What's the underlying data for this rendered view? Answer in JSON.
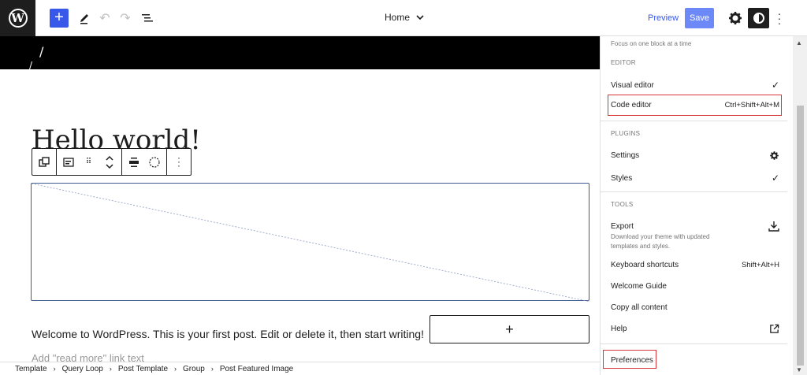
{
  "header": {
    "logo_letter": "W",
    "add_icon": "plus-icon",
    "doc_title": "Home",
    "preview_label": "Preview",
    "save_label": "Save"
  },
  "canvas": {
    "post_title": "Hello world!",
    "excerpt": "Welcome to WordPress. This is your first post. Edit or delete it, then start writing!",
    "readmore": "Add \"read more\" link text",
    "appender_symbol": "+"
  },
  "breadcrumb": [
    "Template",
    "Query Loop",
    "Post Template",
    "Group",
    "Post Featured Image"
  ],
  "menu": {
    "spotlight_hint": "Focus on one block at a time",
    "editor_heading": "EDITOR",
    "visual_editor": "Visual editor",
    "code_editor": "Code editor",
    "code_editor_shortcut": "Ctrl+Shift+Alt+M",
    "plugins_heading": "PLUGINS",
    "settings": "Settings",
    "styles": "Styles",
    "tools_heading": "TOOLS",
    "export": "Export",
    "export_hint": "Download your theme with updated templates and styles.",
    "keyboard_shortcuts": "Keyboard shortcuts",
    "keyboard_shortcuts_key": "Shift+Alt+H",
    "welcome_guide": "Welcome Guide",
    "copy_all": "Copy all content",
    "help": "Help",
    "preferences": "Preferences"
  },
  "colors": {
    "accent": "#3858e9",
    "highlight": "#d63638"
  }
}
